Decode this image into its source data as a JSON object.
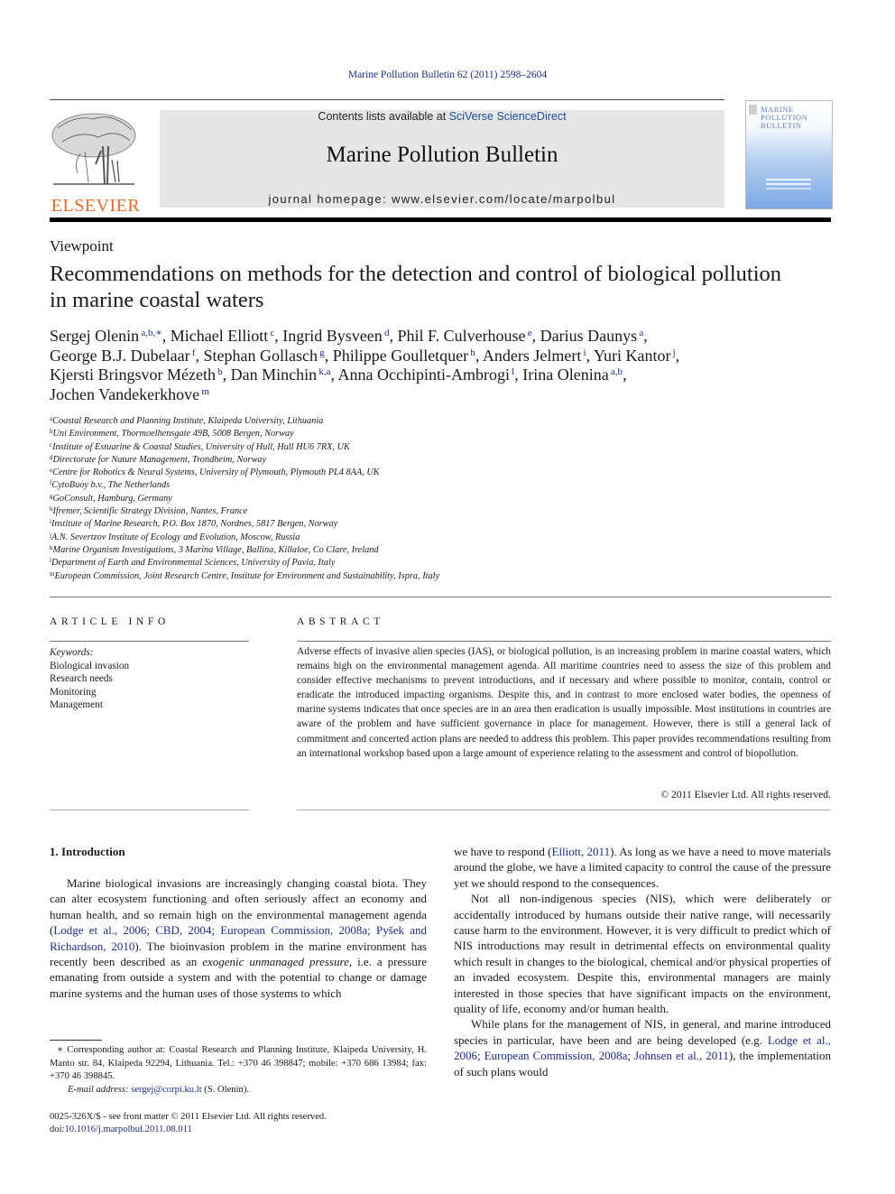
{
  "header": {
    "citation": "Marine Pollution Bulletin 62 (2011) 2598–2604",
    "publisher_logo_text": "ELSEVIER",
    "contents_prefix": "Contents lists available at ",
    "contents_link": "SciVerse ScienceDirect",
    "journal_title": "Marine Pollution Bulletin",
    "homepage": "journal homepage: www.elsevier.com/locate/marpolbul",
    "cover_title_lines": [
      "MARINE",
      "POLLUTION",
      "BULLETIN"
    ]
  },
  "article": {
    "section_type": "Viewpoint",
    "title": "Recommendations on methods for the detection and control of biological pollution in marine coastal waters",
    "authors": [
      {
        "name": "Sergej Olenin",
        "sup": "a,b,∗"
      },
      {
        "name": "Michael Elliott",
        "sup": "c"
      },
      {
        "name": "Ingrid Bysveen",
        "sup": "d"
      },
      {
        "name": "Phil F. Culverhouse",
        "sup": "e"
      },
      {
        "name": "Darius Daunys",
        "sup": "a"
      },
      {
        "name": "George B.J. Dubelaar",
        "sup": "f"
      },
      {
        "name": "Stephan Gollasch",
        "sup": "g"
      },
      {
        "name": "Philippe Goulletquer",
        "sup": "h"
      },
      {
        "name": "Anders Jelmert",
        "sup": "i"
      },
      {
        "name": "Yuri Kantor",
        "sup": "j"
      },
      {
        "name": "Kjersti Bringsvor Mézeth",
        "sup": "b"
      },
      {
        "name": "Dan Minchin",
        "sup": "k,a"
      },
      {
        "name": "Anna Occhipinti-Ambrogi",
        "sup": "l"
      },
      {
        "name": "Irina Olenina",
        "sup": "a,b"
      },
      {
        "name": "Jochen Vandekerkhove",
        "sup": "m"
      }
    ],
    "affiliations": [
      {
        "key": "a",
        "text": "Coastal Research and Planning Institute, Klaipeda University, Lithuania"
      },
      {
        "key": "b",
        "text": "Uni Environment, Thormoelhensgate 49B, 5008 Bergen, Norway"
      },
      {
        "key": "c",
        "text": "Institute of Estuarine & Coastal Studies, University of Hull, Hull HU6 7RX, UK"
      },
      {
        "key": "d",
        "text": "Directorate for Nature Management, Trondheim, Norway"
      },
      {
        "key": "e",
        "text": "Centre for Robotics & Neural Systems, University of Plymouth, Plymouth PL4 8AA, UK"
      },
      {
        "key": "f",
        "text": "CytoBuoy b.v., The Netherlands"
      },
      {
        "key": "g",
        "text": "GoConsult, Hamburg, Germany"
      },
      {
        "key": "h",
        "text": "Ifremer, Scientific Strategy Division, Nantes, France"
      },
      {
        "key": "i",
        "text": "Institute of Marine Research, P.O. Box 1870, Nordnes, 5817 Bergen, Norway"
      },
      {
        "key": "j",
        "text": "A.N. Severtzov Institute of Ecology and Evolution, Moscow, Russia"
      },
      {
        "key": "k",
        "text": "Marine Organism Investigations, 3 Marina Village, Ballina, Killaloe, Co Clare, Ireland"
      },
      {
        "key": "l",
        "text": "Department of Earth and Environmental Sciences, University of Pavia, Italy"
      },
      {
        "key": "m",
        "text": "European Commission, Joint Research Centre, Institute for Environment and Sustainability, Ispra, Italy"
      }
    ]
  },
  "article_info": {
    "heading": "ARTICLE INFO",
    "keywords_label": "Keywords:",
    "keywords": [
      "Biological invasion",
      "Research needs",
      "Monitoring",
      "Management"
    ]
  },
  "abstract": {
    "heading": "ABSTRACT",
    "text": "Adverse effects of invasive alien species (IAS), or biological pollution, is an increasing problem in marine coastal waters, which remains high on the environmental management agenda. All maritime countries need to assess the size of this problem and consider effective mechanisms to prevent introductions, and if necessary and where possible to monitor, contain, control or eradicate the introduced impacting organisms. Despite this, and in contrast to more enclosed water bodies, the openness of marine systems indicates that once species are in an area then eradication is usually impossible. Most institutions in countries are aware of the problem and have sufficient governance in place for management. However, there is still a general lack of commitment and concerted action plans are needed to address this problem. This paper provides recommendations resulting from an international workshop based upon a large amount of experience relating to the assessment and control of biopollution.",
    "copyright": "© 2011 Elsevier Ltd. All rights reserved."
  },
  "introduction": {
    "heading": "1. Introduction",
    "col1_p1": [
      {
        "t": "Marine biological invasions are increasingly changing coastal biota. They can alter ecosystem functioning and often seriously affect an economy and human health, and so remain high on the environmental management agenda ("
      },
      {
        "t": "Lodge et al., 2006; CBD, 2004; European Commission, 2008a; Pyšek and Richardson, 2010",
        "link": true
      },
      {
        "t": "). The bioinvasion problem in the marine environment has recently been described as an "
      },
      {
        "t": "exogenic unmanaged pressure",
        "italic": true
      },
      {
        "t": ", i.e. a pressure emanating from outside a system and with the potential to change or damage marine systems and the human uses of those systems to which"
      }
    ],
    "col2_p1": [
      {
        "t": "we have to respond ("
      },
      {
        "t": "Elliott, 2011",
        "link": true
      },
      {
        "t": "). As long as we have a need to move materials around the globe, we have a limited capacity to control the cause of the pressure yet we should respond to the consequences."
      }
    ],
    "col2_p2": [
      {
        "t": "Not all non-indigenous species (NIS), which were deliberately or accidentally introduced by humans outside their native range, will necessarily cause harm to the environment. However, it is very difficult to predict which of NIS introductions may result in detrimental effects on environmental quality which result in changes to the biological, chemical and/or physical properties of an invaded ecosystem. Despite this, environmental managers are mainly interested in those species that have significant impacts on the environment, quality of life, economy and/or human health."
      }
    ],
    "col2_p3": [
      {
        "t": "While plans for the management of NIS, in general, and marine introduced species in particular, have been and are being developed (e.g. "
      },
      {
        "t": "Lodge et al., 2006; European Commission, 2008a; Johnsen et al., 2011",
        "link": true
      },
      {
        "t": "), the implementation of such plans would"
      }
    ]
  },
  "footnote": {
    "corresponding": "∗ Corresponding author at: Coastal Research and Planning Institute, Klaipeda University, H. Manto str. 84, Klaipeda 92294, Lithuania. Tel.: +370 46 398847; mobile: +370 686 13984; fax: +370 46 398845.",
    "email_label": "E-mail address:",
    "email": "sergej@corpi.ku.lt",
    "email_suffix": " (S. Olenin).",
    "front_matter": "0025-326X/$ - see front matter © 2011 Elsevier Ltd. All rights reserved.",
    "doi_label": "doi:",
    "doi": "10.1016/j.marpolbul.2011.08.011"
  },
  "colors": {
    "link": "#1c2b8c",
    "elsevier_orange": "#f06a24",
    "masthead_bg": "#e6e6e6"
  }
}
